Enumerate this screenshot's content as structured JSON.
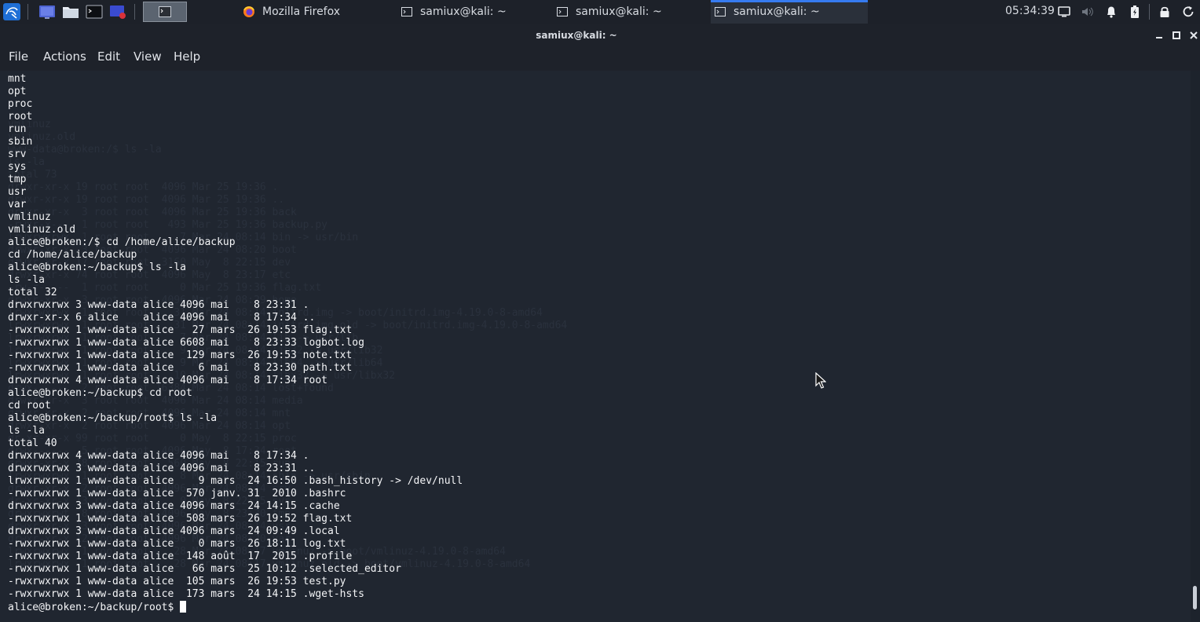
{
  "panel": {
    "tasks": [
      {
        "label": "Mozilla Firefox",
        "icon": "firefox-icon"
      },
      {
        "label": "samiux@kali: ~",
        "icon": "terminal-icon"
      },
      {
        "label": "samiux@kali: ~",
        "icon": "terminal-icon"
      },
      {
        "label": "samiux@kali: ~",
        "icon": "terminal-icon"
      }
    ],
    "active_task_index": 3,
    "clock": "05:34:39",
    "accent_color": "#367bf0"
  },
  "window": {
    "title": "samiux@kali: ~"
  },
  "menu": {
    "file": "File",
    "actions": "Actions",
    "edit": "Edit",
    "view": "View",
    "help": "Help"
  },
  "terminal": {
    "background_ghost": "vmlinuz\nvmlinuz.old\nwww-data@broken:/$ ls -la\nls -la\ntotal 73\ndrwxr-xr-x 19 root root  4096 Mar 25 19:36 .\ndrwxr-xr-x 19 root root  4096 Mar 25 19:36 ..\ndrwxr-xr-x  3 root root  4096 Mar 25 19:36 back\n-rwxr-x---  1 root root   493 Mar 25 19:36 backup.py\nlrwxrwxrwx  1 root root     7 Mar 24 08:14 bin -> usr/bin\ndrwxr-xr-x  3 root root  4096 Mar 24 08:20 boot\ndrwxr-xr-x 17 root root  3160 May  8 22:15 dev\ndrwxr-xr-x 74 root root  4096 May  8 23:17 etc\n-rw-r-----  1 root root     0 Mar 25 19:36 flag.txt\ndrwxr-xr-x  3 root root  4096 Mar 24 08:29 home\nlrwxrwxrwx  1 root root    31 Mar 24 08:14 initrd.img -> boot/initrd.img-4.19.0-8-amd64\nlrwxrwxrwx  1 root root    31 Mar 24 08:14 initrd.img.old -> boot/initrd.img-4.19.0-8-amd64\nlrwxrwxrwx  1 root root     7 Mar 24 08:14 lib -> usr/lib\nlrwxrwxrwx  1 root root     9 Mar 24 08:14 lib32 -> usr/lib32\nlrwxrwxrwx  1 root root     9 Mar 24 08:14 lib64 -> usr/lib64\nlrwxrwxrwx  1 root root    10 Mar 24 08:14 libx32 -> usr/libx32\ndrwx------  2 root root 16384 Mar 24 08:14 lost+found\ndrwxr-xr-x  3 root root  4096 Mar 24 08:14 media\ndrwxr-xr-x  2 root root  4096 Mar 24 08:14 mnt\ndrwxr-xr-x  2 root root  4096 Mar 24 08:14 opt\ndr-xr-xr-x 99 root root     0 May  8 22:15 proc\ndrwx------  5 root root  4096 May  8 17:34 root\ndrwxr-xr-x 18 root root   560 May  8 22:15 run\nlrwxrwxrwx  1 root root     8 Mar 24 08:14 sbin -> usr/sbin\ndrwxr-xr-x  2 root root  4096 Mar 24 08:14 srv\ndr-xr-xr-x 13 root root     0 May  8 22:15 sys\ndrwxrwxrwt  8 root root  4096 May  8 23:30 tmp\ndrwxr-xr-x 13 root root  4096 Mar 24 08:14 usr\ndrwxr-xr-x 12 root root  4096 Mar 24 08:20 var\nlrwxrwxrwx  1 root root    28 Mar 24 08:17 vmlinuz -> boot/vmlinuz-4.19.0-8-amd64\nlrwxrwxrwx  1 root root    28 Mar 24 08:17 vmlinuz.old -> boot/vmlinuz-4.19.0-8-amd64",
    "output": "mnt\nopt\nproc\nroot\nrun\nsbin\nsrv\nsys\ntmp\nusr\nvar\nvmlinuz\nvmlinuz.old\nalice@broken:/$ cd /home/alice/backup\ncd /home/alice/backup\nalice@broken:~/backup$ ls -la\nls -la\ntotal 32\ndrwxrwxrwx 3 www-data alice 4096 mai    8 23:31 .\ndrwxr-xr-x 6 alice    alice 4096 mai    8 17:34 ..\n-rwxrwxrwx 1 www-data alice   27 mars  26 19:53 flag.txt\n-rwxrwxrwx 1 www-data alice 6608 mai    8 23:33 logbot.log\n-rwxrwxrwx 1 www-data alice  129 mars  26 19:53 note.txt\n-rwxrwxrwx 1 www-data alice    6 mai    8 23:30 path.txt\ndrwxrwxrwx 4 www-data alice 4096 mai    8 17:34 root\nalice@broken:~/backup$ cd root\ncd root\nalice@broken:~/backup/root$ ls -la\nls -la\ntotal 40\ndrwxrwxrwx 4 www-data alice 4096 mai    8 17:34 .\ndrwxrwxrwx 3 www-data alice 4096 mai    8 23:31 ..\nlrwxrwxrwx 1 www-data alice    9 mars  24 16:50 .bash_history -> /dev/null\n-rwxrwxrwx 1 www-data alice  570 janv. 31  2010 .bashrc\ndrwxrwxrwx 3 www-data alice 4096 mars  24 14:15 .cache\n-rwxrwxrwx 1 www-data alice  508 mars  26 19:52 flag.txt\ndrwxrwxrwx 3 www-data alice 4096 mars  24 09:49 .local\n-rwxrwxrwx 1 www-data alice    0 mars  26 18:11 log.txt\n-rwxrwxrwx 1 www-data alice  148 août  17  2015 .profile\n-rwxrwxrwx 1 www-data alice   66 mars  25 10:12 .selected_editor\n-rwxrwxrwx 1 www-data alice  105 mars  26 19:53 test.py\n-rwxrwxrwx 1 www-data alice  173 mars  24 14:15 .wget-hsts\nalice@broken:~/backup/root$ "
  }
}
